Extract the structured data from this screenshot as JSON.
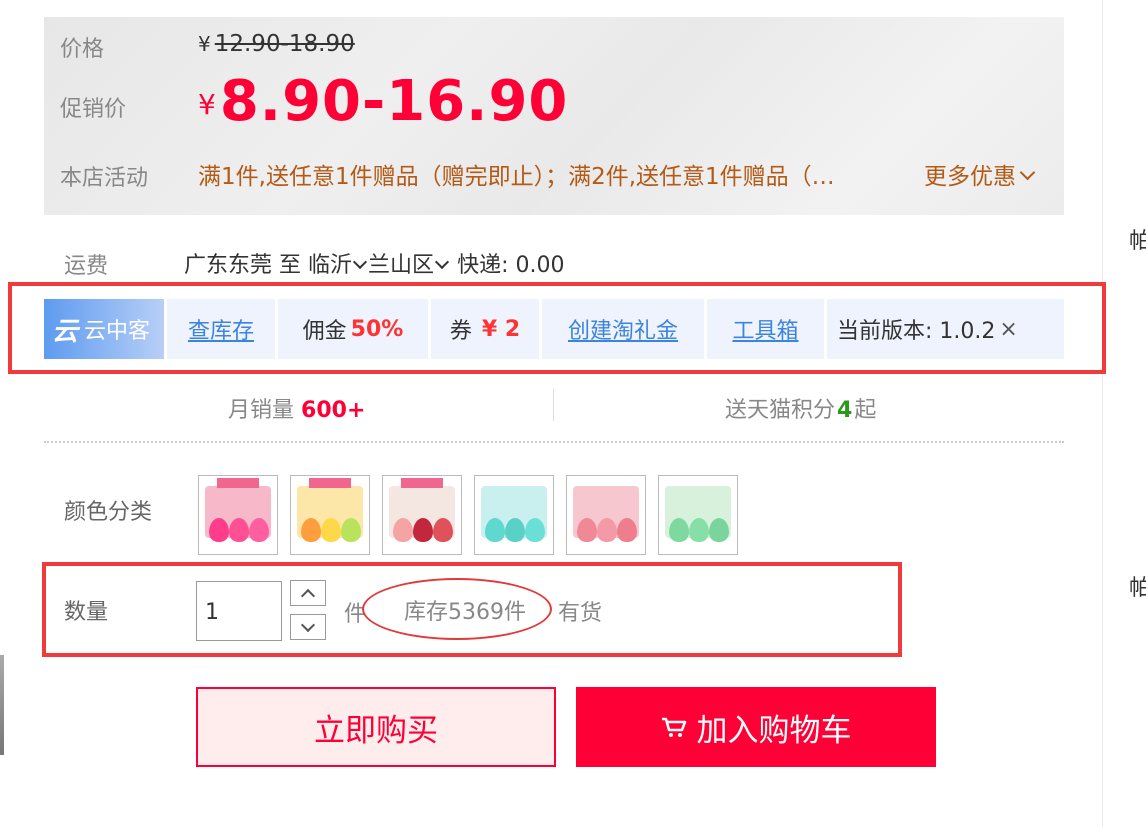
{
  "price_box": {
    "price_label": "价格",
    "original_currency": "¥",
    "original_price": "12.90-18.90",
    "promo_label": "促销价",
    "promo_currency": "¥",
    "promo_price": "8.90-16.90",
    "activity_label": "本店活动",
    "activity_text": "满1件,送任意1件赠品（赠完即止）；满2件,送任意1件赠品（…",
    "more_offers": "更多优惠"
  },
  "shipping": {
    "label": "运费",
    "from": "广东东莞",
    "to_word": "至",
    "city": "临沂",
    "district": "兰山区",
    "method": "快递: 0.00"
  },
  "plugin_bar": {
    "brand": "云中客",
    "logo_glyph": "云",
    "check_stock": "查库存",
    "commission_label": "佣金",
    "commission_value": "50%",
    "coupon_label": "券",
    "coupon_value": "¥ 2",
    "create_gift": "创建淘礼金",
    "toolbox": "工具箱",
    "version": "当前版本: 1.0.2",
    "close": "×"
  },
  "stats": {
    "monthly_sales_label": "月销量",
    "monthly_sales_value": "600+",
    "points_prefix": "送天猫积分",
    "points_value": "4",
    "points_suffix": "起"
  },
  "color_section": {
    "label": "颜色分类",
    "swatches": [
      {
        "box": "#f7b9c9",
        "blobs": [
          "#ff3d8a",
          "#ff4f95",
          "#ff5fa0"
        ],
        "style": "pink"
      },
      {
        "box": "#fde7a8",
        "blobs": [
          "#ff9e3d",
          "#ffd84a",
          "#b9e35a"
        ],
        "style": "yellow"
      },
      {
        "box": "#f4e7e2",
        "blobs": [
          "#f5a3a3",
          "#c3273c",
          "#e0525a"
        ],
        "style": "cream"
      },
      {
        "box": "#c9f0ee",
        "blobs": [
          "#5fd8cf",
          "#5ad1c7",
          "#6adfd6"
        ],
        "style": "teal"
      },
      {
        "box": "#f7c7cf",
        "blobs": [
          "#f08896",
          "#f49aa6",
          "#ee7d8d"
        ],
        "style": "rose"
      },
      {
        "box": "#d7f1dd",
        "blobs": [
          "#7ed9a0",
          "#86dfa7",
          "#7ad49b"
        ],
        "style": "mint"
      }
    ]
  },
  "quantity": {
    "label": "数量",
    "value": "1",
    "unit": "件",
    "stock_text": "库存5369件",
    "availability": "有货"
  },
  "actions": {
    "buy_now": "立即购买",
    "add_to_cart": "加入购物车"
  },
  "side_chars": [
    "帕",
    "帕"
  ],
  "colors": {
    "accent_red": "#ff0036",
    "link_blue": "#3b84e0",
    "activity_brown": "#b35a17",
    "highlight_red": "#f03b3b",
    "points_green": "#2b9a1b"
  }
}
